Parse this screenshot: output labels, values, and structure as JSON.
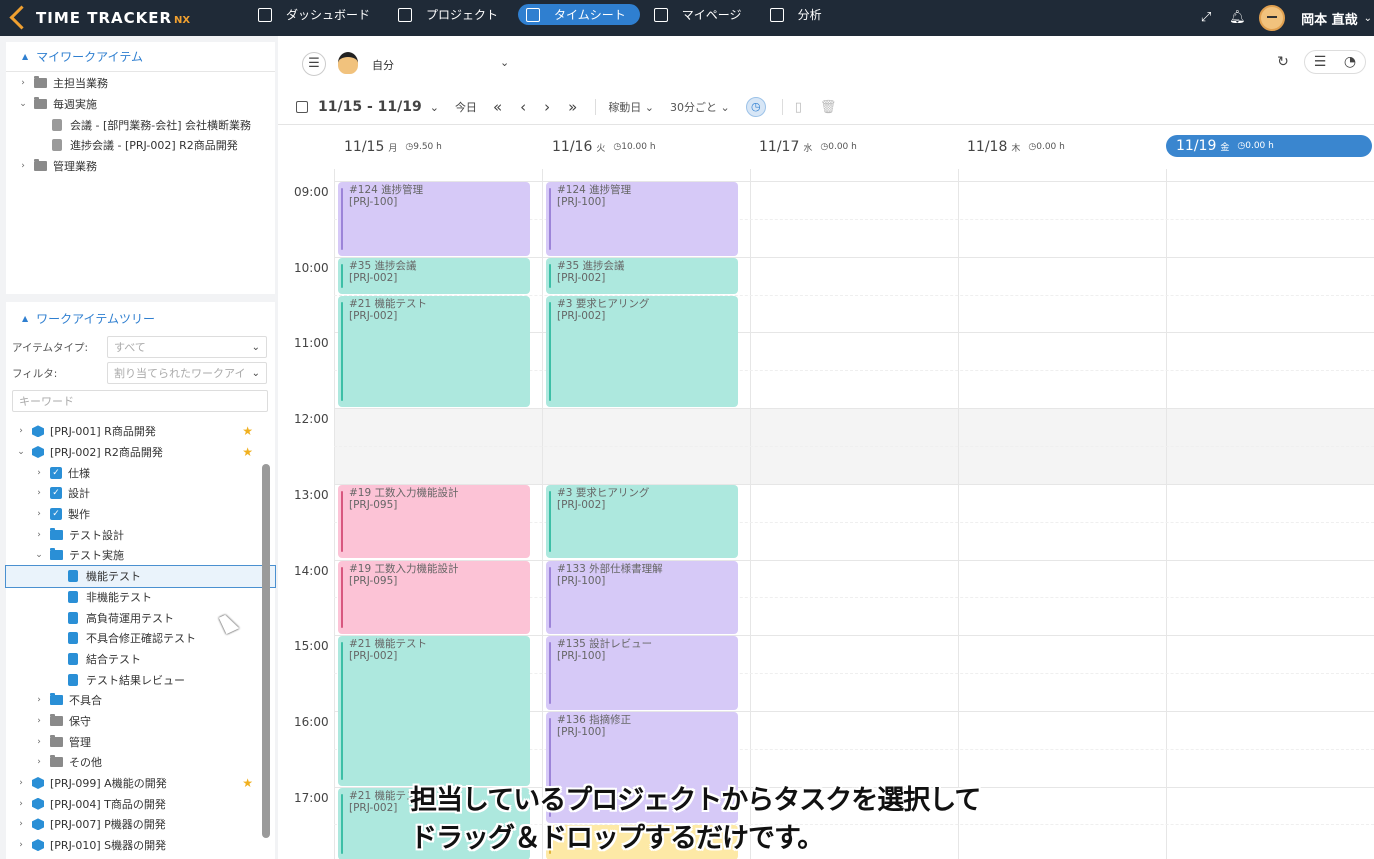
{
  "app": {
    "logo": "TIME TRACKER",
    "logo_suffix": "NX"
  },
  "nav": [
    {
      "label": "ダッシュボード",
      "icon": "home-icon"
    },
    {
      "label": "プロジェクト",
      "icon": "cube-icon"
    },
    {
      "label": "タイムシート",
      "icon": "calendar-icon",
      "active": true
    },
    {
      "label": "マイページ",
      "icon": "person-icon"
    },
    {
      "label": "分析",
      "icon": "bar-chart-icon"
    }
  ],
  "user": {
    "name": "岡本 直哉"
  },
  "my_items": {
    "title": "マイワークアイテム",
    "rows": [
      {
        "label": "主担当業務",
        "arrow": "›",
        "type": "folder"
      },
      {
        "label": "毎週実施",
        "arrow": "⌄",
        "type": "folder"
      },
      {
        "label": "会議 - [部門業務-会社] 会社横断業務",
        "type": "clip"
      },
      {
        "label": "進捗会議 - [PRJ-002] R2商品開発",
        "type": "clip"
      },
      {
        "label": "管理業務",
        "arrow": "›",
        "type": "folder"
      }
    ]
  },
  "tree": {
    "title": "ワークアイテムツリー",
    "item_type_label": "アイテムタイプ:",
    "item_type_value": "すべて",
    "filter_label": "フィルタ:",
    "filter_value": "割り当てられたワークアイ",
    "keyword_placeholder": "キーワード",
    "rows": [
      {
        "label": "[PRJ-001] R商品開発",
        "level": 0,
        "arrow": "›",
        "type": "cube",
        "star": true
      },
      {
        "label": "[PRJ-002] R2商品開発",
        "level": 0,
        "arrow": "⌄",
        "type": "cube",
        "star": true
      },
      {
        "label": "仕様",
        "level": 1,
        "arrow": "›",
        "type": "check"
      },
      {
        "label": "設計",
        "level": 1,
        "arrow": "›",
        "type": "check"
      },
      {
        "label": "製作",
        "level": 1,
        "arrow": "›",
        "type": "check"
      },
      {
        "label": "テスト設計",
        "level": 1,
        "arrow": "›",
        "type": "folder-blue"
      },
      {
        "label": "テスト実施",
        "level": 1,
        "arrow": "⌄",
        "type": "folder-blue"
      },
      {
        "label": "機能テスト",
        "level": 2,
        "type": "clip-blue",
        "selected": true
      },
      {
        "label": "非機能テスト",
        "level": 2,
        "type": "clip-blue"
      },
      {
        "label": "高負荷運用テスト",
        "level": 2,
        "type": "clip-blue"
      },
      {
        "label": "不具合修正確認テスト",
        "level": 2,
        "type": "clip-blue"
      },
      {
        "label": "結合テスト",
        "level": 2,
        "type": "clip-blue"
      },
      {
        "label": "テスト結果レビュー",
        "level": 2,
        "type": "clip-blue"
      },
      {
        "label": "不具合",
        "level": 1,
        "arrow": "›",
        "type": "folder-blue"
      },
      {
        "label": "保守",
        "level": 1,
        "arrow": "›",
        "type": "folder"
      },
      {
        "label": "管理",
        "level": 1,
        "arrow": "›",
        "type": "folder"
      },
      {
        "label": "その他",
        "level": 1,
        "arrow": "›",
        "type": "folder"
      },
      {
        "label": "[PRJ-099] A機能の開発",
        "level": 0,
        "arrow": "›",
        "type": "cube",
        "star": true
      },
      {
        "label": "[PRJ-004] T商品の開発",
        "level": 0,
        "arrow": "›",
        "type": "cube"
      },
      {
        "label": "[PRJ-007] P機器の開発",
        "level": 0,
        "arrow": "›",
        "type": "cube"
      },
      {
        "label": "[PRJ-010] S機器の開発",
        "level": 0,
        "arrow": "›",
        "type": "cube"
      }
    ]
  },
  "main": {
    "user_select": "自分",
    "range": "11/15 - 11/19",
    "today": "今日",
    "day_type": "稼動日",
    "interval": "30分ごと"
  },
  "days": [
    {
      "date": "11/15",
      "dow": "月",
      "hours": "9.50 h"
    },
    {
      "date": "11/16",
      "dow": "火",
      "hours": "10.00 h"
    },
    {
      "date": "11/17",
      "dow": "水",
      "hours": "0.00 h"
    },
    {
      "date": "11/18",
      "dow": "木",
      "hours": "0.00 h"
    },
    {
      "date": "11/19",
      "dow": "金",
      "hours": "0.00 h",
      "today": true
    }
  ],
  "hours": [
    "09:00",
    "10:00",
    "11:00",
    "12:00",
    "13:00",
    "14:00",
    "15:00",
    "16:00",
    "17:00"
  ],
  "events": [
    {
      "day": 0,
      "start": 9.0,
      "end": 10.0,
      "title": "#124 進捗管理",
      "code": "[PRJ-100]",
      "color": "purple"
    },
    {
      "day": 0,
      "start": 10.0,
      "end": 10.5,
      "title": "#35 進捗会議",
      "code": "[PRJ-002]",
      "color": "teal"
    },
    {
      "day": 0,
      "start": 10.5,
      "end": 12.0,
      "title": "#21 機能テスト",
      "code": "[PRJ-002]",
      "color": "teal"
    },
    {
      "day": 0,
      "start": 13.0,
      "end": 14.0,
      "title": "#19 工数入力機能設計",
      "code": "[PRJ-095]",
      "color": "pink"
    },
    {
      "day": 0,
      "start": 14.0,
      "end": 15.0,
      "title": "#19 工数入力機能設計",
      "code": "[PRJ-095]",
      "color": "pink"
    },
    {
      "day": 0,
      "start": 15.0,
      "end": 17.0,
      "title": "#21 機能テスト",
      "code": "[PRJ-002]",
      "color": "teal"
    },
    {
      "day": 0,
      "start": 17.0,
      "end": 18.0,
      "title": "#21 機能テスト",
      "code": "[PRJ-002]",
      "color": "teal"
    },
    {
      "day": 1,
      "start": 9.0,
      "end": 10.0,
      "title": "#124 進捗管理",
      "code": "[PRJ-100]",
      "color": "purple"
    },
    {
      "day": 1,
      "start": 10.0,
      "end": 10.5,
      "title": "#35 進捗会議",
      "code": "[PRJ-002]",
      "color": "teal"
    },
    {
      "day": 1,
      "start": 10.5,
      "end": 12.0,
      "title": "#3 要求ヒアリング",
      "code": "[PRJ-002]",
      "color": "teal"
    },
    {
      "day": 1,
      "start": 13.0,
      "end": 14.0,
      "title": "#3 要求ヒアリング",
      "code": "[PRJ-002]",
      "color": "teal"
    },
    {
      "day": 1,
      "start": 14.0,
      "end": 15.0,
      "title": "#133 外部仕様書理解",
      "code": "[PRJ-100]",
      "color": "purple"
    },
    {
      "day": 1,
      "start": 15.0,
      "end": 16.0,
      "title": "#135 設計レビュー",
      "code": "[PRJ-100]",
      "color": "purple"
    },
    {
      "day": 1,
      "start": 16.0,
      "end": 17.5,
      "title": "#136 指摘修正",
      "code": "[PRJ-100]",
      "color": "purple"
    },
    {
      "day": 1,
      "start": 17.5,
      "end": 18.0,
      "title": "",
      "code": "",
      "color": "yellow"
    }
  ],
  "caption": {
    "line1": "担当しているプロジェクトからタスクを選択して",
    "line2": "ドラッグ＆ドロップするだけです。"
  }
}
